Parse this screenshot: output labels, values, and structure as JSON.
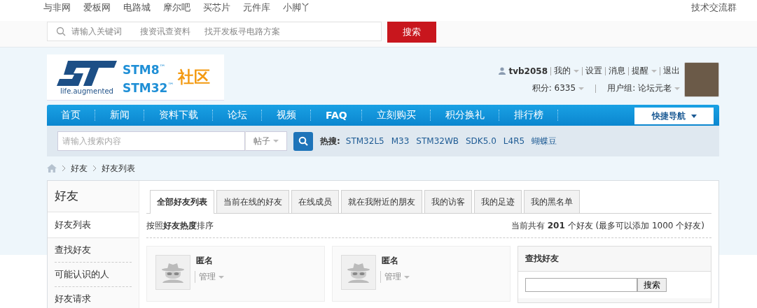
{
  "top_links": [
    {
      "label": "与非网"
    },
    {
      "label": "爱板网"
    },
    {
      "label": "电路城"
    },
    {
      "label": "摩尔吧"
    },
    {
      "label": "买芯片"
    },
    {
      "label": "元件库"
    },
    {
      "label": "小脚丫"
    }
  ],
  "top_right": "技术交流群",
  "site_search": {
    "placeholder": "请输入关键词",
    "hints": [
      "搜资讯查资料",
      "找开发板寻电路方案"
    ],
    "button": "搜索"
  },
  "logo": {
    "tagline": "life.augmented",
    "line1": "STM8",
    "line2": "STM32",
    "tm": "™",
    "brand": "社区"
  },
  "user": {
    "name": "tvb2058",
    "links": [
      {
        "label": "我的",
        "dropdown": true
      },
      {
        "label": "设置",
        "dropdown": false
      },
      {
        "label": "消息",
        "dropdown": false
      },
      {
        "label": "提醒",
        "dropdown": true
      },
      {
        "label": "退出",
        "dropdown": false
      }
    ],
    "points": "积分: 6335",
    "group": "用户组: 论坛元老"
  },
  "nav": {
    "items": [
      {
        "label": "首页",
        "bold": false
      },
      {
        "label": "新闻",
        "bold": false
      },
      {
        "label": "资料下载",
        "bold": false
      },
      {
        "label": "论坛",
        "bold": false
      },
      {
        "label": "视频",
        "bold": false
      },
      {
        "label": "FAQ",
        "bold": true
      },
      {
        "label": "立刻购买",
        "bold": false
      },
      {
        "label": "积分换礼",
        "bold": false
      },
      {
        "label": "排行榜",
        "bold": false
      }
    ],
    "quick_nav": "快捷导航"
  },
  "forum_search": {
    "placeholder": "请输入搜索内容",
    "scope": "帖子",
    "hot_label": "热搜:",
    "hot": [
      "STM32L5",
      "M33",
      "STM32WB",
      "SDK5.0",
      "L4R5",
      "蝴蝶豆"
    ]
  },
  "breadcrumb": [
    "好友",
    "好友列表"
  ],
  "sidebar": {
    "title": "好友",
    "items": [
      {
        "label": "好友列表",
        "selected": true
      },
      {
        "label": "查找好友",
        "selected": false
      },
      {
        "label": "可能认识的人",
        "selected": false
      },
      {
        "label": "好友请求",
        "selected": false
      }
    ]
  },
  "tabs": [
    {
      "label": "全部好友列表",
      "selected": true
    },
    {
      "label": "当前在线的好友",
      "selected": false
    },
    {
      "label": "在线成员",
      "selected": false
    },
    {
      "label": "就在我附近的朋友",
      "selected": false
    },
    {
      "label": "我的访客",
      "selected": false
    },
    {
      "label": "我的足迹",
      "selected": false
    },
    {
      "label": "我的黑名单",
      "selected": false
    }
  ],
  "sort_text": "按照**好友热度**排序",
  "count_text": "当前共有 **201** 个好友 (最多可以添加 1000 个好友)",
  "friends": [
    {
      "name": "匿名",
      "action": "管理"
    },
    {
      "name": "匿名",
      "action": "管理"
    }
  ],
  "find_panel": {
    "title": "查找好友",
    "button": "搜索"
  }
}
